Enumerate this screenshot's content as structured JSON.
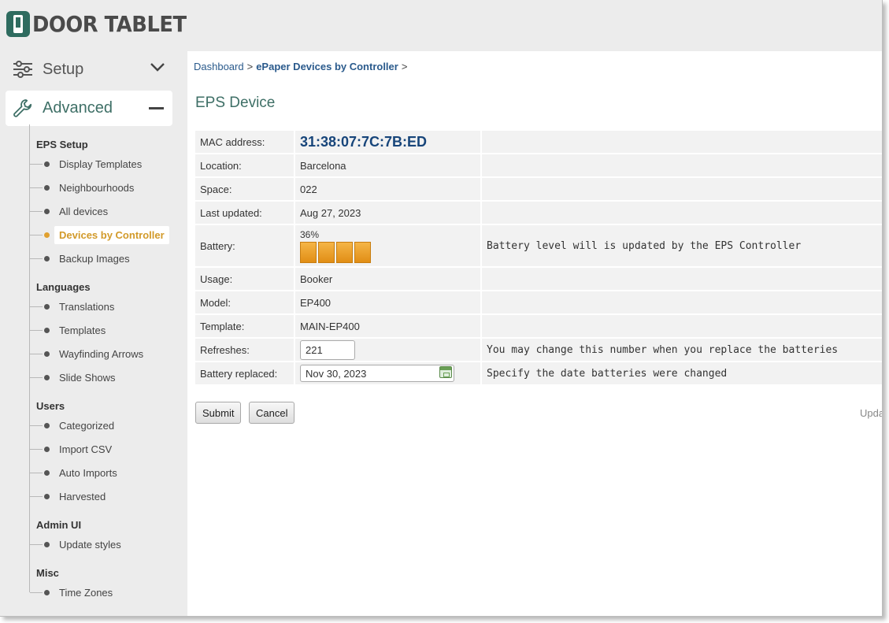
{
  "app": {
    "brand": "DOOR TABLET"
  },
  "sidebar": {
    "setup_label": "Setup",
    "advanced_label": "Advanced",
    "sections": [
      {
        "title": "EPS Setup",
        "items": [
          "Display Templates",
          "Neighbourhoods",
          "All devices",
          "Devices by Controller",
          "Backup Images"
        ]
      },
      {
        "title": "Languages",
        "items": [
          "Translations",
          "Templates",
          "Wayfinding Arrows",
          "Slide Shows"
        ]
      },
      {
        "title": "Users",
        "items": [
          "Categorized",
          "Import CSV",
          "Auto Imports",
          "Harvested"
        ]
      },
      {
        "title": "Admin UI",
        "items": [
          "Update styles"
        ]
      },
      {
        "title": "Misc",
        "items": [
          "Time Zones"
        ]
      }
    ],
    "active_item": "Devices by Controller"
  },
  "breadcrumb": {
    "home": "Dashboard",
    "current": "ePaper Devices by Controller",
    "separator": ">"
  },
  "page": {
    "title": "EPS Device"
  },
  "device": {
    "mac_label": "MAC address:",
    "mac": "31:38:07:7C:7B:ED",
    "location_label": "Location:",
    "location": "Barcelona",
    "space_label": "Space:",
    "space": "022",
    "last_updated_label": "Last updated:",
    "last_updated": "Aug 27, 2023",
    "battery_label": "Battery:",
    "battery_percent_text": "36%",
    "battery_note": "Battery level will is updated by the EPS Controller",
    "usage_label": "Usage:",
    "usage": "Booker",
    "model_label": "Model:",
    "model": "EP400",
    "template_label": "Template:",
    "template": "MAIN-EP400",
    "refreshes_label": "Refreshes:",
    "refreshes": "221",
    "refreshes_note": "You may change this number when you replace the batteries",
    "battery_replaced_label": "Battery replaced:",
    "battery_replaced": "Nov 30, 2023",
    "battery_replaced_note": "Specify the date batteries were changed"
  },
  "actions": {
    "submit": "Submit",
    "cancel": "Cancel",
    "updated_truncated": "Upda"
  },
  "colors": {
    "accent": "#3e6f66",
    "active": "#d29a2a",
    "link": "#2a5a8c",
    "battery": "#e8961e"
  }
}
